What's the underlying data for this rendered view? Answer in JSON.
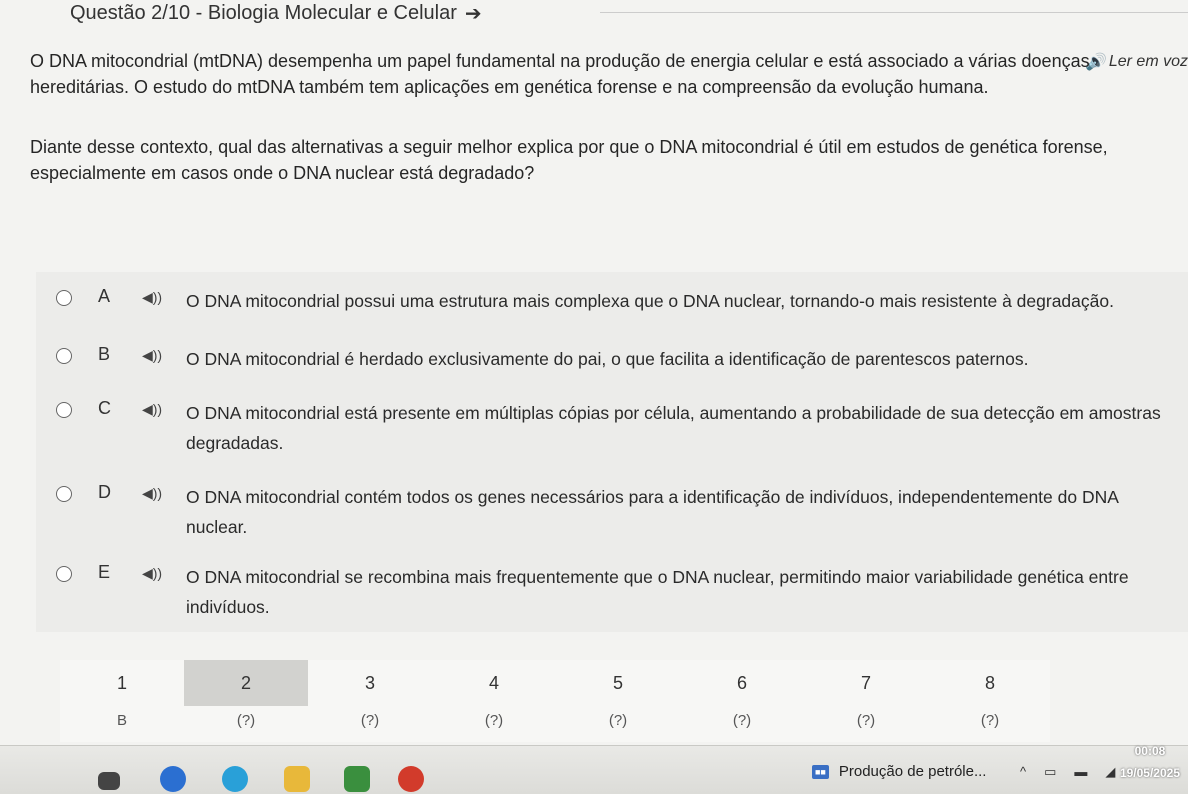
{
  "header": {
    "title": "Questão 2/10 - Biologia Molecular e Celular",
    "arrow_icon": "arrow-right-icon",
    "read_voice_label": "Ler em voz"
  },
  "question": {
    "paragraph1": "O DNA mitocondrial (mtDNA) desempenha um papel fundamental na produção de energia celular e está associado a várias doenças hereditárias. O estudo do mtDNA também tem aplicações em genética forense e na compreensão da evolução humana.",
    "paragraph2": "Diante desse contexto, qual das alternativas a seguir melhor explica por que o DNA mitocondrial é útil em estudos de genética forense, especialmente em casos onde o DNA nuclear está degradado?"
  },
  "options": [
    {
      "letter": "A",
      "text": "O DNA mitocondrial possui uma estrutura mais complexa que o DNA nuclear, tornando-o mais resistente à degradação."
    },
    {
      "letter": "B",
      "text": "O DNA mitocondrial é herdado exclusivamente do pai, o que facilita a identificação de parentescos paternos."
    },
    {
      "letter": "C",
      "text": "O DNA mitocondrial está presente em múltiplas cópias por célula, aumentando a probabilidade de sua detecção em amostras degradadas."
    },
    {
      "letter": "D",
      "text": "O DNA mitocondrial contém todos os genes necessários para a identificação de indivíduos, independentemente do DNA nuclear."
    },
    {
      "letter": "E",
      "text": "O DNA mitocondrial se recombina mais frequentemente que o DNA nuclear, permitindo maior variabilidade genética entre indivíduos."
    }
  ],
  "navigation": [
    {
      "number": "1",
      "answer": "B"
    },
    {
      "number": "2",
      "answer": "(?)"
    },
    {
      "number": "3",
      "answer": "(?)"
    },
    {
      "number": "4",
      "answer": "(?)"
    },
    {
      "number": "5",
      "answer": "(?)"
    },
    {
      "number": "6",
      "answer": "(?)"
    },
    {
      "number": "7",
      "answer": "(?)"
    },
    {
      "number": "8",
      "answer": "(?)"
    }
  ],
  "taskbar": {
    "notification": "Produção de petróle...",
    "time": "00:08",
    "date": "19/05/2025"
  }
}
